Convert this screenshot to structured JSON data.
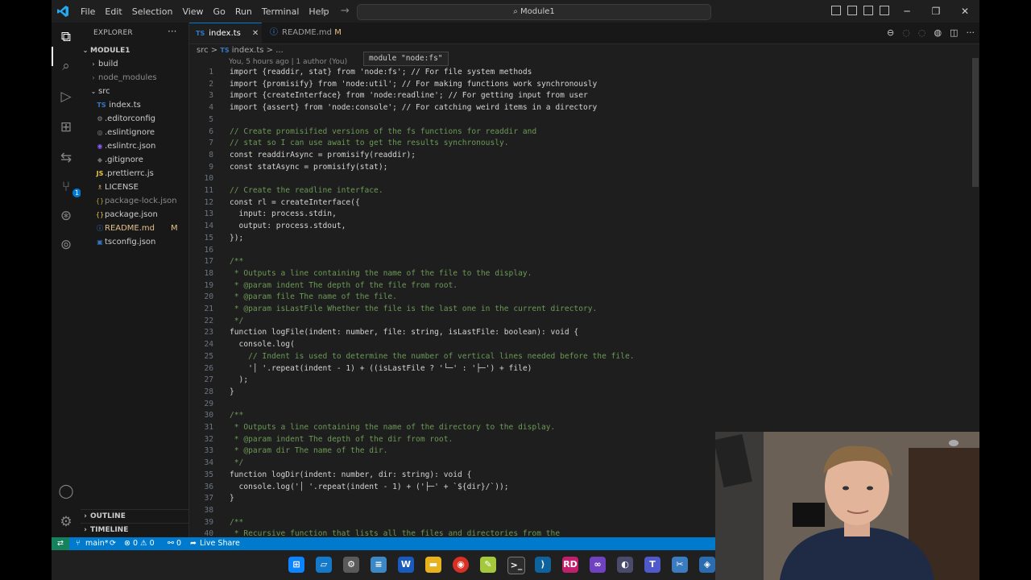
{
  "menu": [
    "File",
    "Edit",
    "Selection",
    "View",
    "Go",
    "Run",
    "Terminal",
    "Help"
  ],
  "search": {
    "label": "Module1"
  },
  "explorer": {
    "header": "EXPLORER",
    "root": "MODULE1",
    "items": [
      {
        "label": "build",
        "kind": "folder"
      },
      {
        "label": "node_modules",
        "kind": "folder-dim"
      },
      {
        "label": "src",
        "kind": "folder-open"
      },
      {
        "label": "index.ts",
        "kind": "ts"
      },
      {
        "label": ".editorconfig",
        "kind": "file"
      },
      {
        "label": ".eslintignore",
        "kind": "file"
      },
      {
        "label": ".eslintrc.json",
        "kind": "file"
      },
      {
        "label": ".gitignore",
        "kind": "file"
      },
      {
        "label": ".prettierrc.js",
        "kind": "js"
      },
      {
        "label": "LICENSE",
        "kind": "file"
      },
      {
        "label": "package-lock.json",
        "kind": "json-dim"
      },
      {
        "label": "package.json",
        "kind": "json"
      },
      {
        "label": "README.md",
        "kind": "md",
        "flag": "M"
      },
      {
        "label": "tsconfig.json",
        "kind": "json"
      }
    ],
    "outline": "OUTLINE",
    "timeline": "TIMELINE"
  },
  "tabs": [
    {
      "label": "index.ts",
      "badge": "TS",
      "close": "✕"
    },
    {
      "label": "README.md",
      "badge": "ⓘ",
      "flag": "M"
    }
  ],
  "breadcrumb": {
    "folder": "src",
    "sep": ">",
    "badge": "TS",
    "file": "index.ts",
    "tail": "> ..."
  },
  "blame": "You, 5 hours ago | 1 author (You)",
  "hover": "module \"node:fs\"",
  "code": [
    {
      "n": "1",
      "t": "import {readdir, stat} from 'node:fs'; // For file system methods"
    },
    {
      "n": "2",
      "t": "import {promisify} from 'node:util'; // For making functions work synchronously"
    },
    {
      "n": "3",
      "t": "import {createInterface} from 'node:readline'; // For getting input from user"
    },
    {
      "n": "4",
      "t": "import {assert} from 'node:console'; // For catching weird items in a directory"
    },
    {
      "n": "5",
      "t": ""
    },
    {
      "n": "6",
      "t": "// Create promisified versions of the fs functions for readdir and"
    },
    {
      "n": "7",
      "t": "// stat so I can use await to get the results synchronously."
    },
    {
      "n": "8",
      "t": "const readdirAsync = promisify(readdir);"
    },
    {
      "n": "9",
      "t": "const statAsync = promisify(stat);"
    },
    {
      "n": "10",
      "t": ""
    },
    {
      "n": "11",
      "t": "// Create the readline interface."
    },
    {
      "n": "12",
      "t": "const rl = createInterface({"
    },
    {
      "n": "13",
      "t": "  input: process.stdin,"
    },
    {
      "n": "14",
      "t": "  output: process.stdout,"
    },
    {
      "n": "15",
      "t": "});"
    },
    {
      "n": "16",
      "t": ""
    },
    {
      "n": "17",
      "t": "/**"
    },
    {
      "n": "18",
      "t": " * Outputs a line containing the name of the file to the display."
    },
    {
      "n": "19",
      "t": " * @param indent The depth of the file from root."
    },
    {
      "n": "20",
      "t": " * @param file The name of the file."
    },
    {
      "n": "21",
      "t": " * @param isLastFile Whether the file is the last one in the current directory."
    },
    {
      "n": "22",
      "t": " */"
    },
    {
      "n": "23",
      "t": "function logFile(indent: number, file: string, isLastFile: boolean): void {"
    },
    {
      "n": "24",
      "t": "  console.log("
    },
    {
      "n": "25",
      "t": "    // Indent is used to determine the number of vertical lines needed before the file."
    },
    {
      "n": "26",
      "t": "    '│ '.repeat(indent - 1) + ((isLastFile ? '└─' : '├─') + file)"
    },
    {
      "n": "27",
      "t": "  );"
    },
    {
      "n": "28",
      "t": "}"
    },
    {
      "n": "29",
      "t": ""
    },
    {
      "n": "30",
      "t": "/**"
    },
    {
      "n": "31",
      "t": " * Outputs a line containing the name of the directory to the display."
    },
    {
      "n": "32",
      "t": " * @param indent The depth of the dir from root."
    },
    {
      "n": "33",
      "t": " * @param dir The name of the dir."
    },
    {
      "n": "34",
      "t": " */"
    },
    {
      "n": "35",
      "t": "function logDir(indent: number, dir: string): void {"
    },
    {
      "n": "36",
      "t": "  console.log('│ '.repeat(indent - 1) + ('├─' + `${dir}/`));"
    },
    {
      "n": "37",
      "t": "}"
    },
    {
      "n": "38",
      "t": ""
    },
    {
      "n": "39",
      "t": "/**"
    },
    {
      "n": "40",
      "t": " * Recursive function that lists all the files and directories from the"
    }
  ],
  "status": {
    "remote": "⇄",
    "branch": "main*",
    "sync": "⟳",
    "diagnostics": "⊗ 0 ⚠ 0",
    "ports": "⚯ 0",
    "liveshare": "Live Share"
  },
  "taskbar": [
    "start",
    "explorer-folder",
    "settings",
    "notepad",
    "word",
    "files",
    "chrome",
    "notepad-plus",
    "terminal",
    "vscode",
    "rider",
    "visual-studio",
    "another-app",
    "teams",
    "snipping",
    "extra"
  ],
  "colors": {
    "accent": "#007acc",
    "editor_bg": "#1e1e1e",
    "sidebar_bg": "#181818",
    "comment": "#6a9955",
    "keyword": "#569cd6"
  }
}
